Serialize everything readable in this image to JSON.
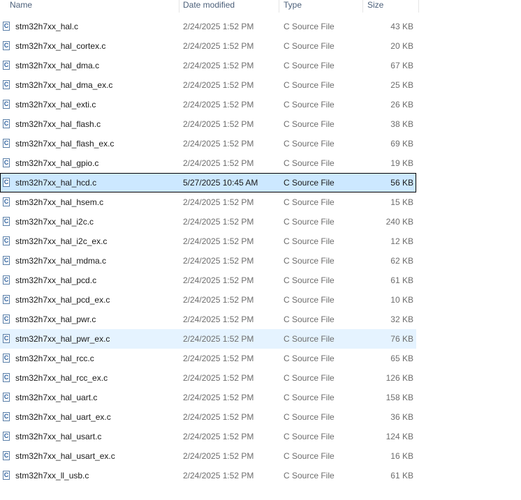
{
  "columns": {
    "name": "Name",
    "date": "Date modified",
    "type": "Type",
    "size": "Size"
  },
  "icon": {
    "glyph": "C",
    "name": "c-source-file-icon"
  },
  "files": [
    {
      "name": "stm32h7xx_hal.c",
      "date": "2/24/2025 1:52 PM",
      "type": "C Source File",
      "size": "43 KB",
      "state": ""
    },
    {
      "name": "stm32h7xx_hal_cortex.c",
      "date": "2/24/2025 1:52 PM",
      "type": "C Source File",
      "size": "20 KB",
      "state": ""
    },
    {
      "name": "stm32h7xx_hal_dma.c",
      "date": "2/24/2025 1:52 PM",
      "type": "C Source File",
      "size": "67 KB",
      "state": ""
    },
    {
      "name": "stm32h7xx_hal_dma_ex.c",
      "date": "2/24/2025 1:52 PM",
      "type": "C Source File",
      "size": "25 KB",
      "state": ""
    },
    {
      "name": "stm32h7xx_hal_exti.c",
      "date": "2/24/2025 1:52 PM",
      "type": "C Source File",
      "size": "26 KB",
      "state": ""
    },
    {
      "name": "stm32h7xx_hal_flash.c",
      "date": "2/24/2025 1:52 PM",
      "type": "C Source File",
      "size": "38 KB",
      "state": ""
    },
    {
      "name": "stm32h7xx_hal_flash_ex.c",
      "date": "2/24/2025 1:52 PM",
      "type": "C Source File",
      "size": "69 KB",
      "state": ""
    },
    {
      "name": "stm32h7xx_hal_gpio.c",
      "date": "2/24/2025 1:52 PM",
      "type": "C Source File",
      "size": "19 KB",
      "state": ""
    },
    {
      "name": "stm32h7xx_hal_hcd.c",
      "date": "5/27/2025 10:45 AM",
      "type": "C Source File",
      "size": "56 KB",
      "state": "selected"
    },
    {
      "name": "stm32h7xx_hal_hsem.c",
      "date": "2/24/2025 1:52 PM",
      "type": "C Source File",
      "size": "15 KB",
      "state": ""
    },
    {
      "name": "stm32h7xx_hal_i2c.c",
      "date": "2/24/2025 1:52 PM",
      "type": "C Source File",
      "size": "240 KB",
      "state": ""
    },
    {
      "name": "stm32h7xx_hal_i2c_ex.c",
      "date": "2/24/2025 1:52 PM",
      "type": "C Source File",
      "size": "12 KB",
      "state": ""
    },
    {
      "name": "stm32h7xx_hal_mdma.c",
      "date": "2/24/2025 1:52 PM",
      "type": "C Source File",
      "size": "62 KB",
      "state": ""
    },
    {
      "name": "stm32h7xx_hal_pcd.c",
      "date": "2/24/2025 1:52 PM",
      "type": "C Source File",
      "size": "61 KB",
      "state": ""
    },
    {
      "name": "stm32h7xx_hal_pcd_ex.c",
      "date": "2/24/2025 1:52 PM",
      "type": "C Source File",
      "size": "10 KB",
      "state": ""
    },
    {
      "name": "stm32h7xx_hal_pwr.c",
      "date": "2/24/2025 1:52 PM",
      "type": "C Source File",
      "size": "32 KB",
      "state": ""
    },
    {
      "name": "stm32h7xx_hal_pwr_ex.c",
      "date": "2/24/2025 1:52 PM",
      "type": "C Source File",
      "size": "76 KB",
      "state": "hovered"
    },
    {
      "name": "stm32h7xx_hal_rcc.c",
      "date": "2/24/2025 1:52 PM",
      "type": "C Source File",
      "size": "65 KB",
      "state": ""
    },
    {
      "name": "stm32h7xx_hal_rcc_ex.c",
      "date": "2/24/2025 1:52 PM",
      "type": "C Source File",
      "size": "126 KB",
      "state": ""
    },
    {
      "name": "stm32h7xx_hal_uart.c",
      "date": "2/24/2025 1:52 PM",
      "type": "C Source File",
      "size": "158 KB",
      "state": ""
    },
    {
      "name": "stm32h7xx_hal_uart_ex.c",
      "date": "2/24/2025 1:52 PM",
      "type": "C Source File",
      "size": "36 KB",
      "state": ""
    },
    {
      "name": "stm32h7xx_hal_usart.c",
      "date": "2/24/2025 1:52 PM",
      "type": "C Source File",
      "size": "124 KB",
      "state": ""
    },
    {
      "name": "stm32h7xx_hal_usart_ex.c",
      "date": "2/24/2025 1:52 PM",
      "type": "C Source File",
      "size": "16 KB",
      "state": ""
    },
    {
      "name": "stm32h7xx_ll_usb.c",
      "date": "2/24/2025 1:52 PM",
      "type": "C Source File",
      "size": "61 KB",
      "state": ""
    }
  ]
}
